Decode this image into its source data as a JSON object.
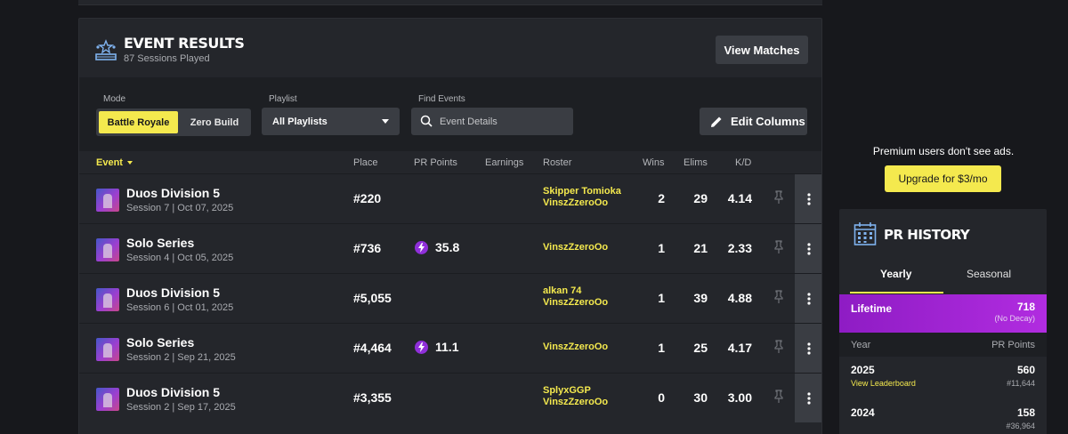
{
  "event_results": {
    "title": "EVENT RESULTS",
    "subtitle": "87 Sessions Played",
    "view_matches_label": "View Matches"
  },
  "filters": {
    "mode_label": "Mode",
    "mode_options": [
      "Battle Royale",
      "Zero Build"
    ],
    "mode_selected": "Battle Royale",
    "playlist_label": "Playlist",
    "playlist_value": "All Playlists",
    "find_label": "Find Events",
    "search_placeholder": "Event Details",
    "edit_columns_label": "Edit Columns"
  },
  "columns": {
    "event": "Event",
    "place": "Place",
    "pr_points": "PR Points",
    "earnings": "Earnings",
    "roster": "Roster",
    "wins": "Wins",
    "elims": "Elims",
    "kd": "K/D"
  },
  "rows": [
    {
      "name": "Duos Division 5",
      "session": "Session 7 | Oct 07, 2025",
      "place": "#220",
      "pr_points": "",
      "roster": [
        "Skipper Tomioka",
        "VinszZzeroOo"
      ],
      "wins": "2",
      "elims": "29",
      "kd": "4.14"
    },
    {
      "name": "Solo Series",
      "session": "Session 4 | Oct 05, 2025",
      "place": "#736",
      "pr_points": "35.8",
      "roster": [
        "VinszZzeroOo"
      ],
      "wins": "1",
      "elims": "21",
      "kd": "2.33"
    },
    {
      "name": "Duos Division 5",
      "session": "Session 6 | Oct 01, 2025",
      "place": "#5,055",
      "pr_points": "",
      "roster": [
        "alkan 74",
        "VinszZzeroOo"
      ],
      "wins": "1",
      "elims": "39",
      "kd": "4.88"
    },
    {
      "name": "Solo Series",
      "session": "Session 2 | Sep 21, 2025",
      "place": "#4,464",
      "pr_points": "11.1",
      "roster": [
        "VinszZzeroOo"
      ],
      "wins": "1",
      "elims": "25",
      "kd": "4.17"
    },
    {
      "name": "Duos Division 5",
      "session": "Session 2 | Sep 17, 2025",
      "place": "#3,355",
      "pr_points": "",
      "roster": [
        "SplyxGGP",
        "VinszZzeroOo"
      ],
      "wins": "0",
      "elims": "30",
      "kd": "3.00"
    }
  ],
  "ad": {
    "text": "Premium users don't see ads.",
    "upgrade_label": "Upgrade for $3/mo"
  },
  "pr_history": {
    "title": "PR HISTORY",
    "tabs": [
      "Yearly",
      "Seasonal"
    ],
    "active_tab": "Yearly",
    "lifetime_label": "Lifetime",
    "lifetime_value": "718",
    "lifetime_note": "(No Decay)",
    "col_year": "Year",
    "col_points": "PR Points",
    "years": [
      {
        "year": "2025",
        "link": "View Leaderboard",
        "points": "560",
        "rank": "#11,644"
      },
      {
        "year": "2024",
        "link": "",
        "points": "158",
        "rank": "#36,964"
      }
    ]
  },
  "colors": {
    "accent_yellow": "#f4e94e",
    "purple": "#8e1cc4",
    "panel": "#24262b",
    "background": "#17181c"
  }
}
